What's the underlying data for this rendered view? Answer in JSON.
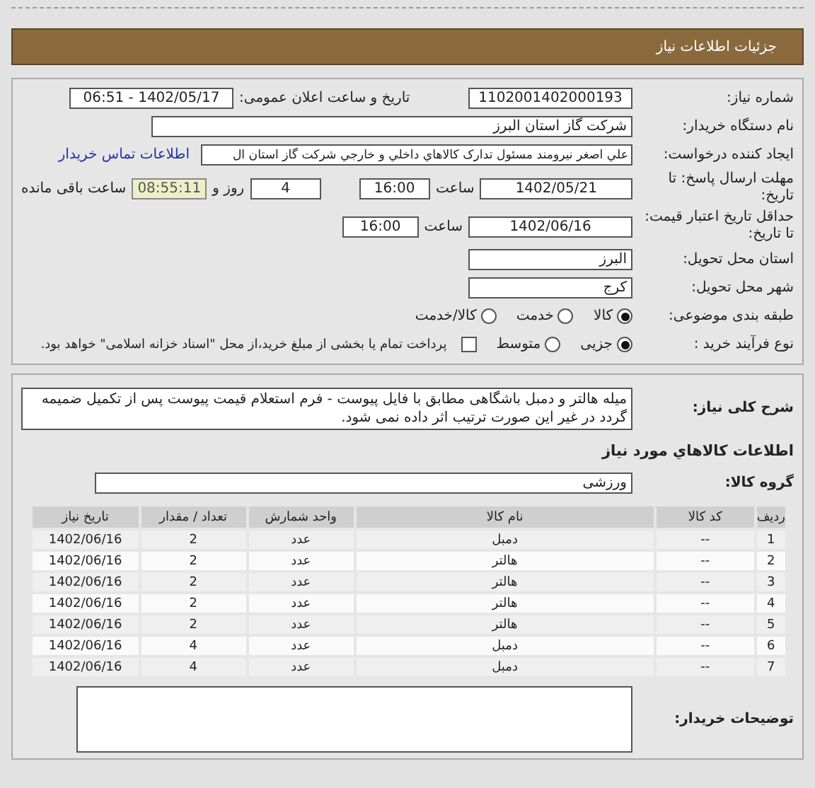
{
  "header": {
    "title": "جزئیات اطلاعات نیاز"
  },
  "need_info": {
    "need_number": {
      "label": "شماره نیاز:",
      "value": "1102001402000193"
    },
    "announce": {
      "label": "تاریخ و ساعت اعلان عمومی:",
      "value": "1402/05/17 - 06:51"
    },
    "buyer": {
      "label": "نام دستگاه خریدار:",
      "value": "شرکت گاز استان البرز"
    },
    "creator": {
      "label": "ایجاد کننده درخواست:",
      "value": "علي اصغر نيرومند مسئول تدارک کالاهاي داخلي و خارجي شرکت گاز استان ال",
      "link": "اطلاعات تماس خریدار"
    },
    "deadline": {
      "label": "مهلت ارسال پاسخ: تا تاریخ:",
      "date": "1402/05/21",
      "time_label": "ساعت",
      "time": "16:00",
      "days": "4",
      "days_label": "روز و",
      "remaining": "08:55:11",
      "remaining_label": "ساعت باقی مانده"
    },
    "validity": {
      "label": "حداقل تاریخ اعتبار قیمت: تا تاریخ:",
      "date": "1402/06/16",
      "time_label": "ساعت",
      "time": "16:00"
    },
    "province": {
      "label": "استان محل تحویل:",
      "value": "البرز"
    },
    "city": {
      "label": "شهر محل تحویل:",
      "value": "کرج"
    },
    "category": {
      "label": "طبقه بندی موضوعی:",
      "options": [
        {
          "label": "کالا",
          "selected": true
        },
        {
          "label": "خدمت",
          "selected": false
        },
        {
          "label": "کالا/خدمت",
          "selected": false
        }
      ]
    },
    "process": {
      "label": "نوع فرآیند خرید :",
      "options": [
        {
          "label": "جزیی",
          "selected": true
        },
        {
          "label": "متوسط",
          "selected": false
        }
      ],
      "payment": {
        "label": "پرداخت تمام یا بخشی از مبلغ خرید،از محل \"اسناد خزانه اسلامی\" خواهد بود.",
        "checked": false
      }
    }
  },
  "goods": {
    "description": {
      "label": "شرح کلی نیاز:",
      "value": "میله هالتر و دمبل باشگاهی مطابق با فایل پیوست - فرم استعلام قیمت پیوست پس از تکمیل ضمیمه گردد در غیر این صورت ترتیب اثر داده نمی شود."
    },
    "section_title": "اطلاعات کالاهاي مورد نیاز",
    "group": {
      "label": "گروه کالا:",
      "value": "ورزشی"
    },
    "table": {
      "columns": [
        "ردیف",
        "کد کالا",
        "نام کالا",
        "واحد شمارش",
        "تعداد / مقدار",
        "تاریخ نیاز"
      ],
      "rows": [
        [
          "1",
          "--",
          "دمبل",
          "عدد",
          "2",
          "1402/06/16"
        ],
        [
          "2",
          "--",
          "هالتر",
          "عدد",
          "2",
          "1402/06/16"
        ],
        [
          "3",
          "--",
          "هالتر",
          "عدد",
          "2",
          "1402/06/16"
        ],
        [
          "4",
          "--",
          "هالتر",
          "عدد",
          "2",
          "1402/06/16"
        ],
        [
          "5",
          "--",
          "هالتر",
          "عدد",
          "2",
          "1402/06/16"
        ],
        [
          "6",
          "--",
          "دمبل",
          "عدد",
          "4",
          "1402/06/16"
        ],
        [
          "7",
          "--",
          "دمبل",
          "عدد",
          "4",
          "1402/06/16"
        ]
      ]
    },
    "buyer_notes": {
      "label": "توضیحات خریدار:"
    }
  }
}
